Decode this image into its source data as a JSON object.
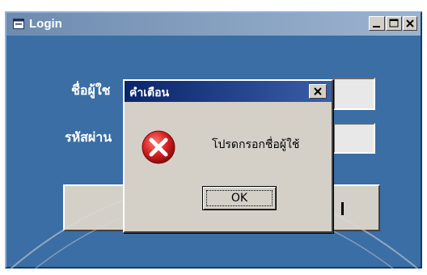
{
  "main_window": {
    "title": "Login",
    "username_label": "ชื่อผู้ใช",
    "password_label": "รหัสผ่าน",
    "minimize_glyph": "_",
    "maximize_glyph": "□",
    "close_glyph": "X"
  },
  "alert_dialog": {
    "title": "คำเตือน",
    "message": "โปรดกรอกชื่อผู้ใช้",
    "ok_label": "OK",
    "close_glyph": "X",
    "icon": "error-icon"
  },
  "colors": {
    "window_bg": "#3a6ea5",
    "dialog_title": "#0a246a",
    "error_red": "#d62020"
  }
}
